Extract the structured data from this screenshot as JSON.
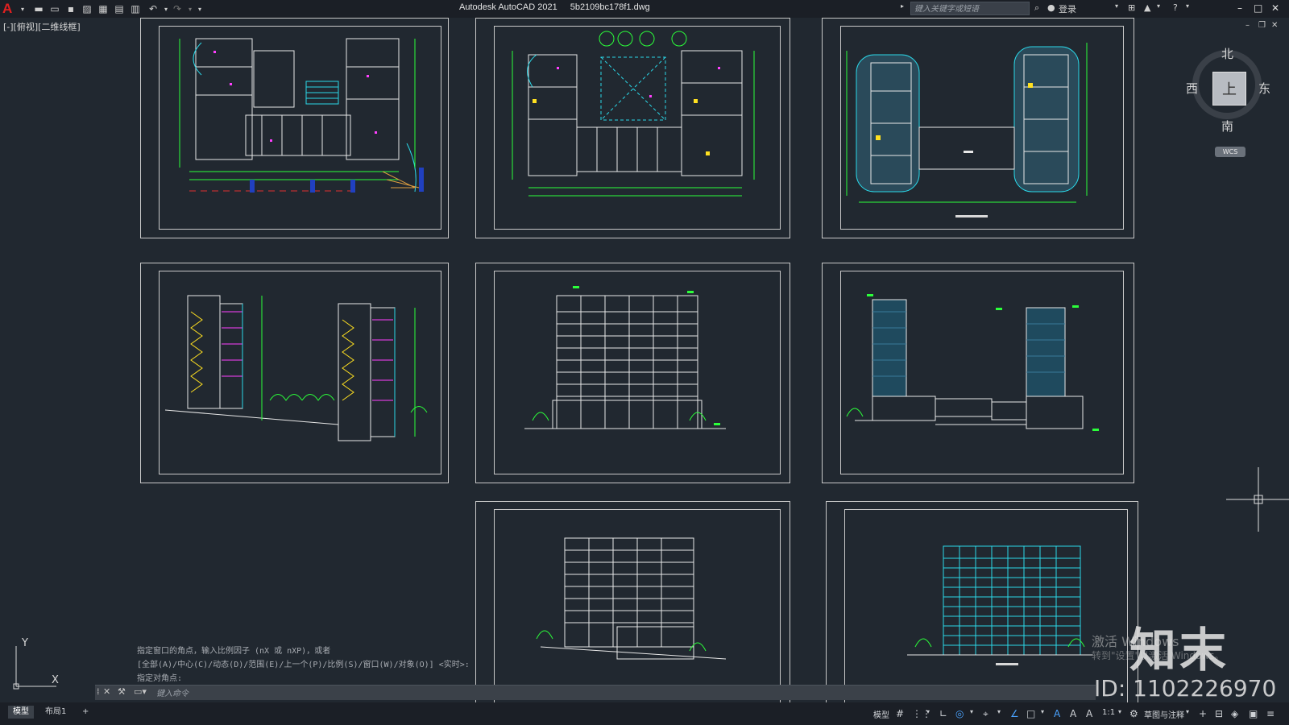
{
  "titlebar": {
    "app": "Autodesk AutoCAD 2021",
    "file": "5b2109bc178f1.dwg",
    "search_placeholder": "键入关键字或短语",
    "login": "登录"
  },
  "viewport_label": "[-][俯视][二维线框]",
  "viewcube": {
    "face": "上",
    "north": "北",
    "south": "南",
    "east": "东",
    "west": "西",
    "wcs": "WCS"
  },
  "command": {
    "history": [
      "指定窗口的角点，输入比例因子 (nX 或 nXP)，或者",
      "[全部(A)/中心(C)/动态(D)/范围(E)/上一个(P)/比例(S)/窗口(W)/对象(O)] <实时>:",
      "指定对角点:"
    ],
    "input_placeholder": "键入命令"
  },
  "status": {
    "tabs": [
      "模型",
      "布局1"
    ],
    "model_label": "模型",
    "scale": "1:1",
    "workspace": "草图与注释"
  },
  "ucs": {
    "x": "X",
    "y": "Y"
  },
  "watermark": {
    "logo": "知末",
    "id": "ID: 1102226970",
    "activate": "激活 Windows",
    "activate_sub": "转到\"设置\"以激活 Windows。"
  },
  "sheets": [
    {
      "kind": "plan-floor"
    },
    {
      "kind": "plan-site"
    },
    {
      "kind": "plan-roof"
    },
    {
      "kind": "section"
    },
    {
      "kind": "elevation-white"
    },
    {
      "kind": "elevation-dark"
    },
    {
      "kind": "elevation-white2"
    },
    {
      "kind": "elevation-cyan"
    }
  ]
}
